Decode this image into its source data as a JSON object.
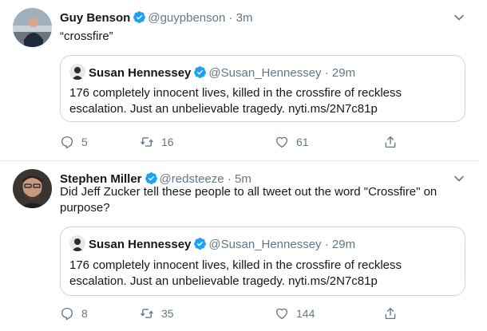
{
  "tweets": [
    {
      "name": "Guy Benson",
      "handle": "@guypbenson",
      "time": "· 3m",
      "text": "“crossfire”",
      "quote": {
        "name": "Susan Hennessey",
        "handle": "@Susan_Hennessey",
        "time": "· 29m",
        "text": "176 completely innocent lives, killed in the crossfire of reckless escalation. Just an unbelievable tragedy. nyti.ms/2N7c81p"
      },
      "replies": "5",
      "retweets": "16",
      "likes": "61"
    },
    {
      "name": "Stephen Miller",
      "handle": "@redsteeze",
      "time": "· 5m",
      "text": "Did Jeff Zucker tell these people to all tweet out the word \"Crossfire\" on purpose?",
      "quote": {
        "name": "Susan Hennessey",
        "handle": "@Susan_Hennessey",
        "time": "· 29m",
        "text": "176 completely innocent lives, killed in the crossfire of reckless escalation. Just an unbelievable tragedy. nyti.ms/2N7c81p"
      },
      "replies": "8",
      "retweets": "35",
      "likes": "144"
    }
  ],
  "icons": {
    "verified": "verified-badge-icon",
    "caret": "chevron-down-icon",
    "reply": "reply-icon",
    "retweet": "retweet-icon",
    "like": "heart-icon",
    "share": "share-icon"
  },
  "colors": {
    "verified": "#1da1f2",
    "secondary_text": "#657786",
    "border": "#e6ecf0"
  }
}
